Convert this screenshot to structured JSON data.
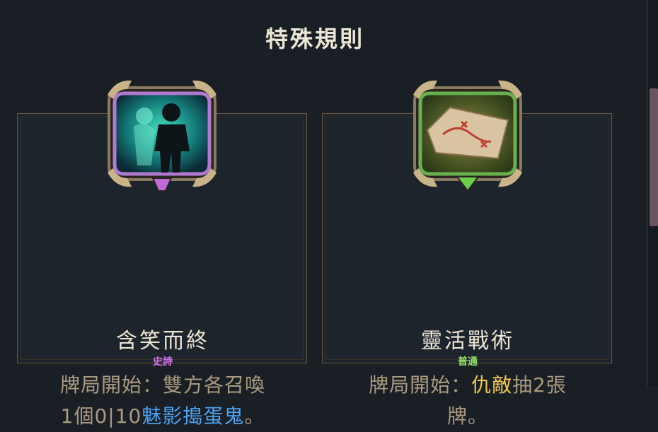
{
  "header": {
    "title": "特殊規則"
  },
  "rules": [
    {
      "name": "含笑而終",
      "rarity": "史詩",
      "rarity_color": "#d86cf0",
      "icon": "ghost-silhouette-icon",
      "frame_color": "#b07ad0",
      "gem_color": "#c06ad8",
      "desc": {
        "line1": "牌局開始：雙方各召喚",
        "line2_prefix": "1個0|10",
        "line2_highlight": "魅影搗蛋鬼",
        "line2_suffix": "。"
      }
    },
    {
      "name": "靈活戰術",
      "rarity": "普通",
      "rarity_color": "#8fe06a",
      "icon": "treasure-map-icon",
      "frame_color": "#6ab04c",
      "gem_color": "#6ad04a",
      "desc": {
        "line1_prefix": "牌局開始：",
        "line1_highlight": "仇敵",
        "line1_suffix": "抽2張",
        "line2": "牌。"
      }
    }
  ]
}
